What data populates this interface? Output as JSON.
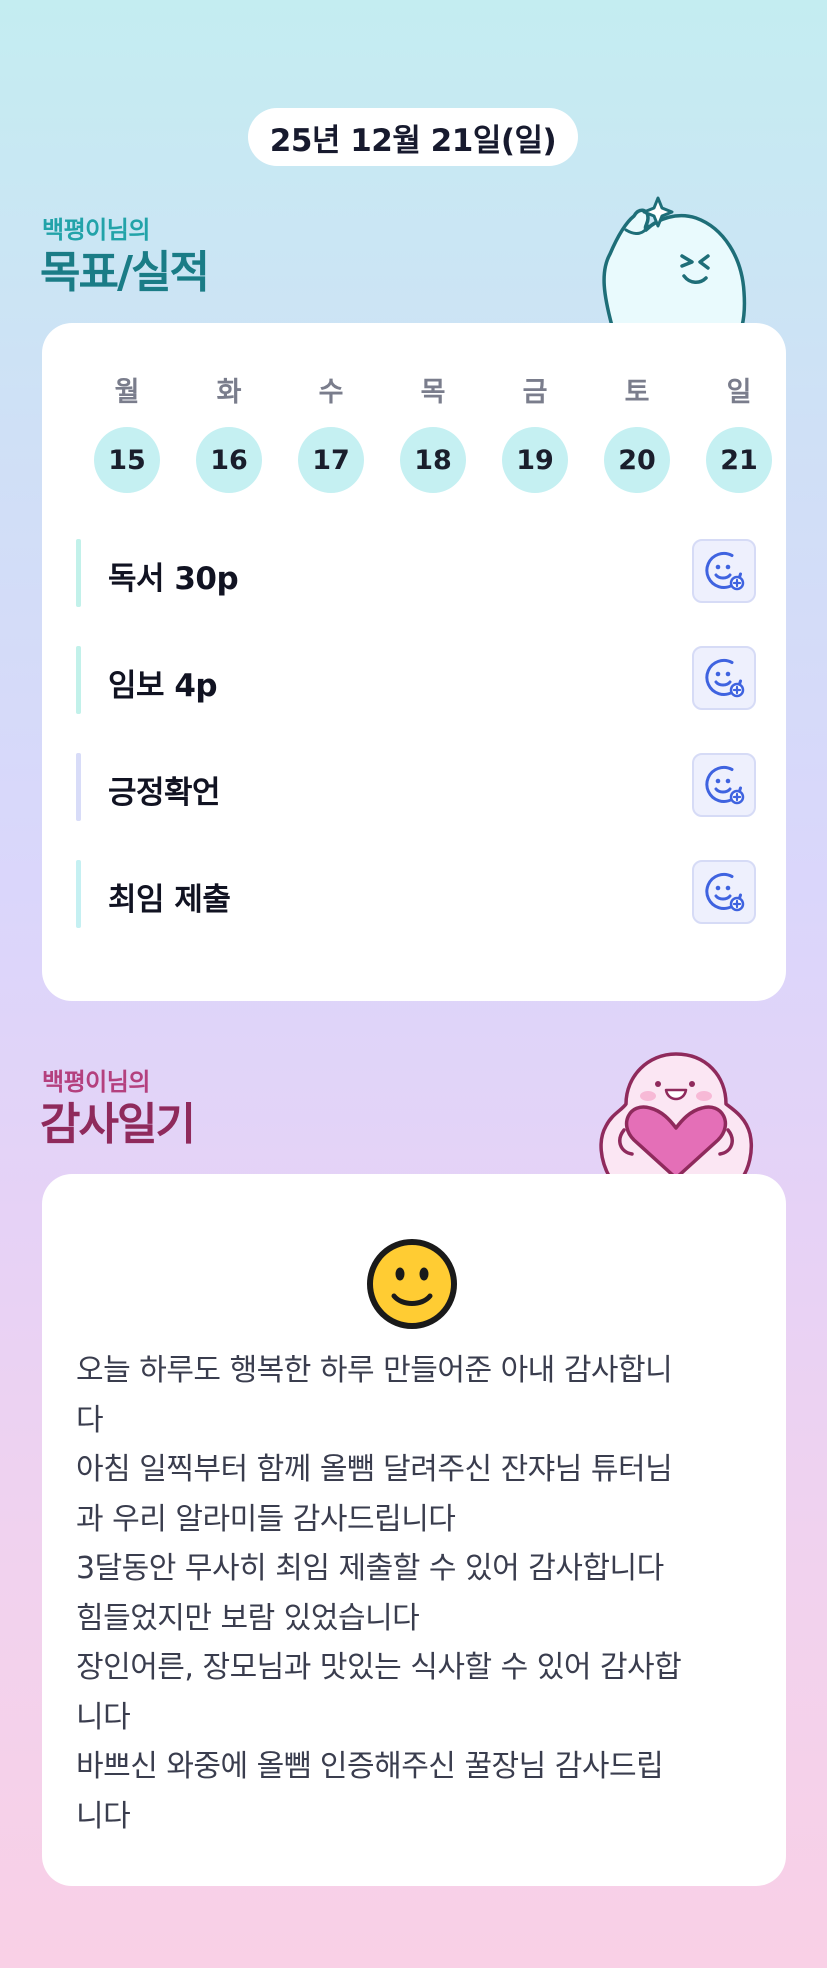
{
  "date_label": "25년 12월 21일(일)",
  "goal_section": {
    "subtitle": "백평이님의",
    "title": "목표/실적",
    "days": [
      {
        "name": "월",
        "num": "15"
      },
      {
        "name": "화",
        "num": "16"
      },
      {
        "name": "수",
        "num": "17"
      },
      {
        "name": "목",
        "num": "18"
      },
      {
        "name": "금",
        "num": "19"
      },
      {
        "name": "토",
        "num": "20"
      },
      {
        "name": "일",
        "num": "21"
      }
    ],
    "goals": [
      {
        "label": "독서 30p",
        "icon": "emoji-add-icon"
      },
      {
        "label": "임보 4p",
        "icon": "emoji-add-icon"
      },
      {
        "label": "긍정확언",
        "icon": "emoji-add-icon"
      },
      {
        "label": "최임 제출",
        "icon": "emoji-add-icon"
      }
    ]
  },
  "gratitude_section": {
    "subtitle": "백평이님의",
    "title": "감사일기",
    "mood_icon": "smiley-face-icon",
    "lines": [
      "오늘 하루도 행복한 하루 만들어준 아내 감사합니",
      "다",
      "아침 일찍부터 함께 올뺌 달려주신 잔쟈님 튜터님",
      "과 우리 알라미들 감사드립니다",
      "3달동안 무사히 최임 제출할 수 있어 감사합니다",
      "힘들었지만 보람 있었습니다",
      "장인어른, 장모님과 맛있는 식사할 수 있어 감사합",
      "니다",
      "바쁘신 와중에 올뺌 인증해주신 꿀장님 감사드립",
      "니다"
    ]
  },
  "colors": {
    "goal_accent": "#1a7c86",
    "gratitude_accent": "#8f2a5c",
    "day_circle": "#c5f0f2",
    "icon_blue": "#3f63e0"
  }
}
